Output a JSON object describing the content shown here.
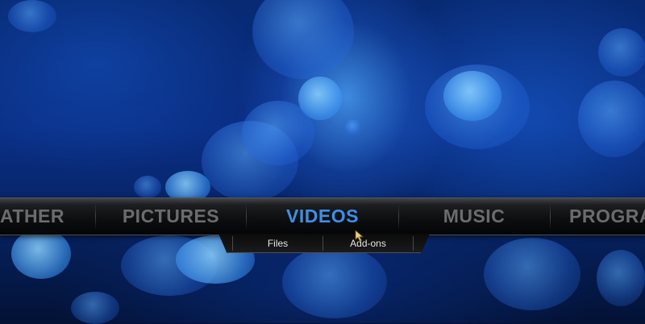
{
  "main_menu": {
    "items": [
      {
        "label": "ATHER",
        "state": "partial"
      },
      {
        "label": "PICTURES",
        "state": "inactive"
      },
      {
        "label": "VIDEOS",
        "state": "active"
      },
      {
        "label": "MUSIC",
        "state": "inactive"
      },
      {
        "label": "PROGRA",
        "state": "partial"
      }
    ]
  },
  "submenu": {
    "items": [
      {
        "label": "Files"
      },
      {
        "label": "Add-ons"
      }
    ]
  },
  "colors": {
    "active": "#3b8fe6",
    "inactive": "#6c6c6c",
    "submenu_text": "#e6e6e6"
  },
  "icons": {
    "pointer": "mouse-pointer-icon"
  }
}
